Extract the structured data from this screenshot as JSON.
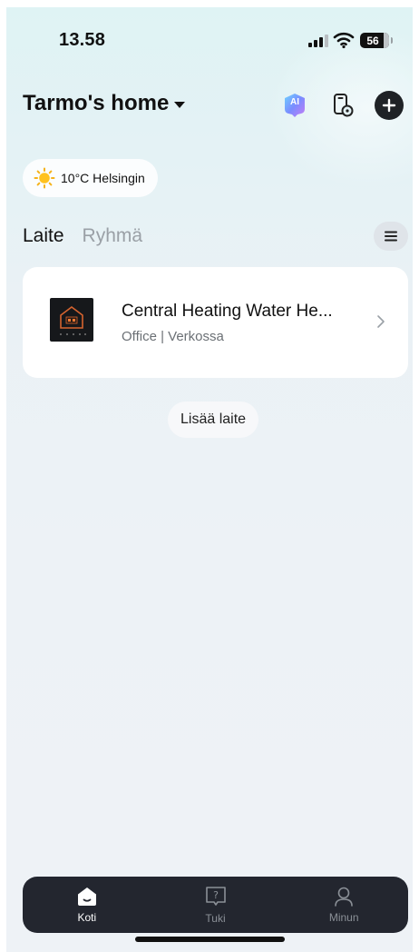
{
  "status_bar": {
    "time": "13.58",
    "battery": "56"
  },
  "header": {
    "home_name": "Tarmo's home",
    "ai_icon_label": "AI"
  },
  "weather": {
    "text": "10°C Helsingin",
    "icon": "sun-icon"
  },
  "tabs": [
    {
      "label": "Laite",
      "active": true
    },
    {
      "label": "Ryhmä",
      "active": false
    }
  ],
  "devices": [
    {
      "name": "Central Heating Water He...",
      "subtitle": "Office | Verkossa"
    }
  ],
  "add_device_label": "Lisää laite",
  "bottom_nav": [
    {
      "label": "Koti",
      "icon": "home-icon",
      "active": true
    },
    {
      "label": "Tuki",
      "icon": "help-icon",
      "active": false
    },
    {
      "label": "Minun",
      "icon": "profile-icon",
      "active": false
    }
  ],
  "colors": {
    "nav_bg": "#23262f",
    "card_bg": "#ffffff",
    "accent_dark": "#1f2226"
  }
}
